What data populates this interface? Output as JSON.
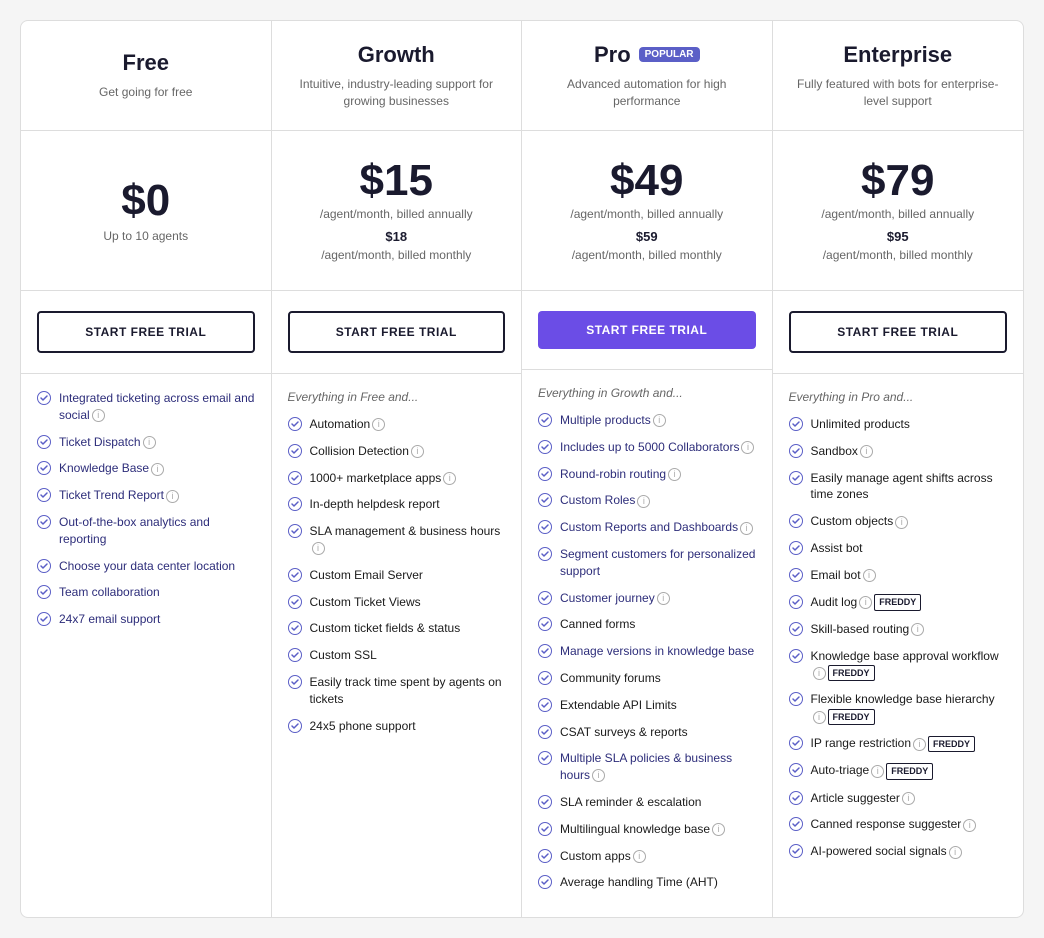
{
  "plans": [
    {
      "id": "free",
      "name": "Free",
      "popular": false,
      "description": "Get going for free",
      "price": "$0",
      "sub_label": "Up to 10 agents",
      "billing_annual": null,
      "price_monthly": null,
      "billing_monthly": null,
      "cta": "START FREE TRIAL",
      "cta_style": "outline",
      "features_header": null,
      "features": [
        {
          "text": "Integrated ticketing across email and social",
          "info": true,
          "highlight": true
        },
        {
          "text": "Ticket Dispatch",
          "info": true,
          "highlight": true
        },
        {
          "text": "Knowledge Base",
          "info": true,
          "highlight": true
        },
        {
          "text": "Ticket Trend Report",
          "info": true,
          "highlight": true
        },
        {
          "text": "Out-of-the-box analytics and reporting",
          "info": false,
          "highlight": true
        },
        {
          "text": "Choose your data center location",
          "info": false,
          "highlight": true
        },
        {
          "text": "Team collaboration",
          "info": false,
          "highlight": true
        },
        {
          "text": "24x7 email support",
          "info": false,
          "highlight": true
        }
      ]
    },
    {
      "id": "growth",
      "name": "Growth",
      "popular": false,
      "description": "Intuitive, industry-leading support for growing businesses",
      "price": "$15",
      "billing_annual": "/agent/month, billed annually",
      "price_monthly": "$18",
      "billing_monthly": "/agent/month, billed monthly",
      "cta": "START FREE TRIAL",
      "cta_style": "outline",
      "features_header": "Everything in Free and...",
      "features": [
        {
          "text": "Automation",
          "info": true,
          "highlight": false
        },
        {
          "text": "Collision Detection",
          "info": true,
          "highlight": false
        },
        {
          "text": "1000+ marketplace apps",
          "info": true,
          "highlight": false
        },
        {
          "text": "In-depth helpdesk report",
          "info": false,
          "highlight": false
        },
        {
          "text": "SLA management & business hours",
          "info": true,
          "highlight": false
        },
        {
          "text": "Custom Email Server",
          "info": false,
          "highlight": false
        },
        {
          "text": "Custom Ticket Views",
          "info": false,
          "highlight": false
        },
        {
          "text": "Custom ticket fields & status",
          "info": false,
          "highlight": false
        },
        {
          "text": "Custom SSL",
          "info": false,
          "highlight": false
        },
        {
          "text": "Easily track time spent by agents on tickets",
          "info": false,
          "highlight": false
        },
        {
          "text": "24x5 phone support",
          "info": false,
          "highlight": false
        }
      ]
    },
    {
      "id": "pro",
      "name": "Pro",
      "popular": true,
      "description": "Advanced automation for high performance",
      "price": "$49",
      "billing_annual": "/agent/month, billed annually",
      "price_monthly": "$59",
      "billing_monthly": "/agent/month, billed monthly",
      "cta": "START FREE TRIAL",
      "cta_style": "filled",
      "features_header": "Everything in Growth and...",
      "features": [
        {
          "text": "Multiple products",
          "info": true,
          "highlight": true
        },
        {
          "text": "Includes up to 5000 Collaborators",
          "info": true,
          "highlight": true
        },
        {
          "text": "Round-robin routing",
          "info": true,
          "highlight": true
        },
        {
          "text": "Custom Roles",
          "info": true,
          "highlight": true
        },
        {
          "text": "Custom Reports and Dashboards",
          "info": true,
          "highlight": true
        },
        {
          "text": "Segment customers for personalized support",
          "info": false,
          "highlight": true
        },
        {
          "text": "Customer journey",
          "info": true,
          "highlight": true
        },
        {
          "text": "Canned forms",
          "info": false,
          "highlight": false
        },
        {
          "text": "Manage versions in knowledge base",
          "info": false,
          "highlight": true
        },
        {
          "text": "Community forums",
          "info": false,
          "highlight": false
        },
        {
          "text": "Extendable API Limits",
          "info": false,
          "highlight": false
        },
        {
          "text": "CSAT surveys & reports",
          "info": false,
          "highlight": false
        },
        {
          "text": "Multiple SLA policies & business hours",
          "info": true,
          "highlight": true
        },
        {
          "text": "SLA reminder & escalation",
          "info": false,
          "highlight": false
        },
        {
          "text": "Multilingual knowledge base",
          "info": true,
          "highlight": false
        },
        {
          "text": "Custom apps",
          "info": true,
          "highlight": false
        },
        {
          "text": "Average handling Time (AHT)",
          "info": false,
          "highlight": false
        }
      ]
    },
    {
      "id": "enterprise",
      "name": "Enterprise",
      "popular": false,
      "description": "Fully featured with bots for enterprise-level support",
      "price": "$79",
      "billing_annual": "/agent/month, billed annually",
      "price_monthly": "$95",
      "billing_monthly": "/agent/month, billed monthly",
      "cta": "START FREE TRIAL",
      "cta_style": "outline",
      "features_header": "Everything in Pro and...",
      "features": [
        {
          "text": "Unlimited products",
          "info": false,
          "highlight": false,
          "freddy": false
        },
        {
          "text": "Sandbox",
          "info": true,
          "highlight": false,
          "freddy": false
        },
        {
          "text": "Easily manage agent shifts across time zones",
          "info": false,
          "highlight": false,
          "freddy": false
        },
        {
          "text": "Custom objects",
          "info": true,
          "highlight": false,
          "freddy": false
        },
        {
          "text": "Assist bot",
          "info": false,
          "highlight": false,
          "freddy": false
        },
        {
          "text": "Email bot",
          "info": true,
          "highlight": false,
          "freddy": false
        },
        {
          "text": "Audit log",
          "info": true,
          "highlight": false,
          "freddy": true
        },
        {
          "text": "Skill-based routing",
          "info": true,
          "highlight": false,
          "freddy": false
        },
        {
          "text": "Knowledge base approval workflow",
          "info": true,
          "highlight": false,
          "freddy": true
        },
        {
          "text": "Flexible knowledge base hierarchy",
          "info": true,
          "highlight": false,
          "freddy": true
        },
        {
          "text": "IP range restriction",
          "info": true,
          "highlight": false,
          "freddy": true,
          "freddy_inline": true
        },
        {
          "text": "Auto-triage",
          "info": true,
          "highlight": false,
          "freddy": true
        },
        {
          "text": "Article suggester",
          "info": true,
          "highlight": false,
          "freddy": false
        },
        {
          "text": "Canned response suggester",
          "info": true,
          "highlight": false,
          "freddy": false
        },
        {
          "text": "AI-powered social signals",
          "info": true,
          "highlight": false,
          "freddy": false
        }
      ]
    }
  ],
  "labels": {
    "popular_badge": "POPULAR",
    "freddy_badge": "FREDDY"
  }
}
